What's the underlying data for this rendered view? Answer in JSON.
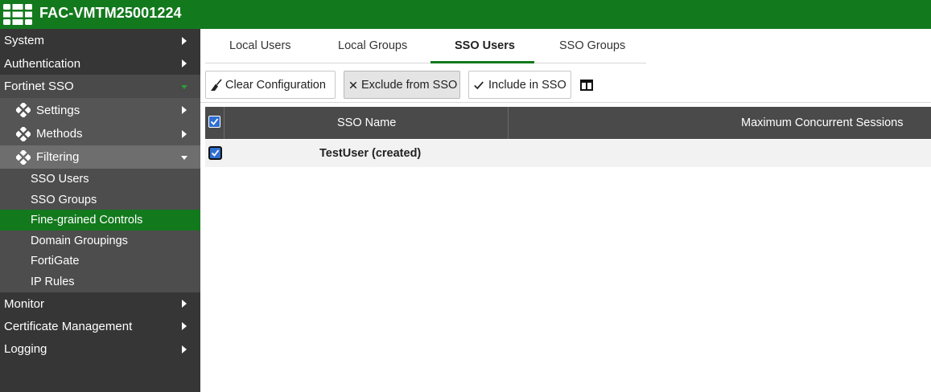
{
  "header": {
    "hostname": "FAC-VMTM25001224"
  },
  "sidebar": {
    "items": [
      {
        "label": "System"
      },
      {
        "label": "Authentication"
      },
      {
        "label": "Fortinet SSO"
      },
      {
        "label": "Settings"
      },
      {
        "label": "Methods"
      },
      {
        "label": "Filtering"
      },
      {
        "label": "SSO Users"
      },
      {
        "label": "SSO Groups"
      },
      {
        "label": "Fine-grained Controls"
      },
      {
        "label": "Domain Groupings"
      },
      {
        "label": "FortiGate"
      },
      {
        "label": "IP Rules"
      },
      {
        "label": "Monitor"
      },
      {
        "label": "Certificate Management"
      },
      {
        "label": "Logging"
      }
    ],
    "active_item": "Fine-grained Controls"
  },
  "tabs": [
    {
      "label": "Local Users"
    },
    {
      "label": "Local Groups"
    },
    {
      "label": "SSO Users"
    },
    {
      "label": "SSO Groups"
    }
  ],
  "active_tab": "SSO Users",
  "toolbar": {
    "clear_label": "Clear Configuration",
    "exclude_label": "Exclude from SSO",
    "include_label": "Include in SSO"
  },
  "table": {
    "columns": [
      "SSO Name",
      "Maximum Concurrent Sessions"
    ],
    "rows": [
      {
        "sso_name": "TestUser (created)",
        "max_sessions": "",
        "checked": true
      }
    ]
  },
  "colors": {
    "brand_green": "#13791d",
    "sidebar_bg": "#363636",
    "checkbox_blue": "#2f6fd1"
  }
}
